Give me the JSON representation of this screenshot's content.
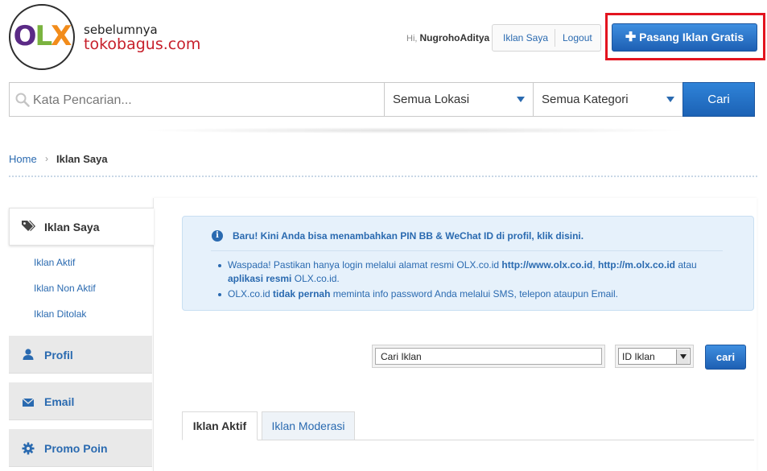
{
  "header": {
    "logo": {
      "o": "O",
      "l": "L",
      "x": "X"
    },
    "tagline_small": "sebelumnya",
    "tagline_big": "tokobagus.com",
    "greeting_prefix": "Hi,",
    "username": "NugrohoAditya",
    "my_ads_link": "Iklan Saya",
    "logout_link": "Logout",
    "post_ad_button": "Pasang Iklan Gratis",
    "post_ad_icon": "plus-icon"
  },
  "search": {
    "placeholder": "Kata Pencarian...",
    "location_select": "Semua Lokasi",
    "category_select": "Semua Kategori",
    "submit_label": "Cari"
  },
  "breadcrumb": {
    "home": "Home",
    "separator": "›",
    "current": "Iklan Saya"
  },
  "sidebar": {
    "active_label": "Iklan Saya",
    "sub_items": [
      {
        "label": "Iklan Aktif"
      },
      {
        "label": "Iklan Non Aktif"
      },
      {
        "label": "Iklan Ditolak"
      }
    ],
    "tabs": [
      {
        "label": "Profil",
        "icon": "user-icon"
      },
      {
        "label": "Email",
        "icon": "envelope-icon"
      },
      {
        "label": "Promo Poin",
        "icon": "gear-icon"
      }
    ]
  },
  "notice": {
    "icon": "info-icon",
    "title": "Baru! Kini Anda bisa menambahkan PIN BB & WeChat ID di profil,",
    "title_link": "klik disini.",
    "bullet1_a": "Waspada! Pastikan hanya login melalui alamat resmi OLX.co.id",
    "bullet1_url1": "http://www.olx.co.id",
    "bullet1_comma": ",",
    "bullet1_url2": "http://m.olx.co.id",
    "bullet1_or": "atau",
    "bullet1_app": "aplikasi resmi",
    "bullet1_end": "OLX.co.id.",
    "bullet2_a": "OLX.co.id",
    "bullet2_b": "tidak pernah",
    "bullet2_c": "meminta info password Anda melalui SMS, telepon ataupun Email."
  },
  "ad_search": {
    "input_value": "Cari Iklan",
    "filter_select": "ID Iklan",
    "submit_label": "cari"
  },
  "tabs": {
    "active": "Iklan Aktif",
    "inactive": "Iklan Moderasi"
  },
  "colors": {
    "link_blue": "#2a6ab0",
    "button_blue": "#1d5fb3",
    "highlight_red": "#e3141f",
    "notice_bg": "#e6f1fb"
  }
}
